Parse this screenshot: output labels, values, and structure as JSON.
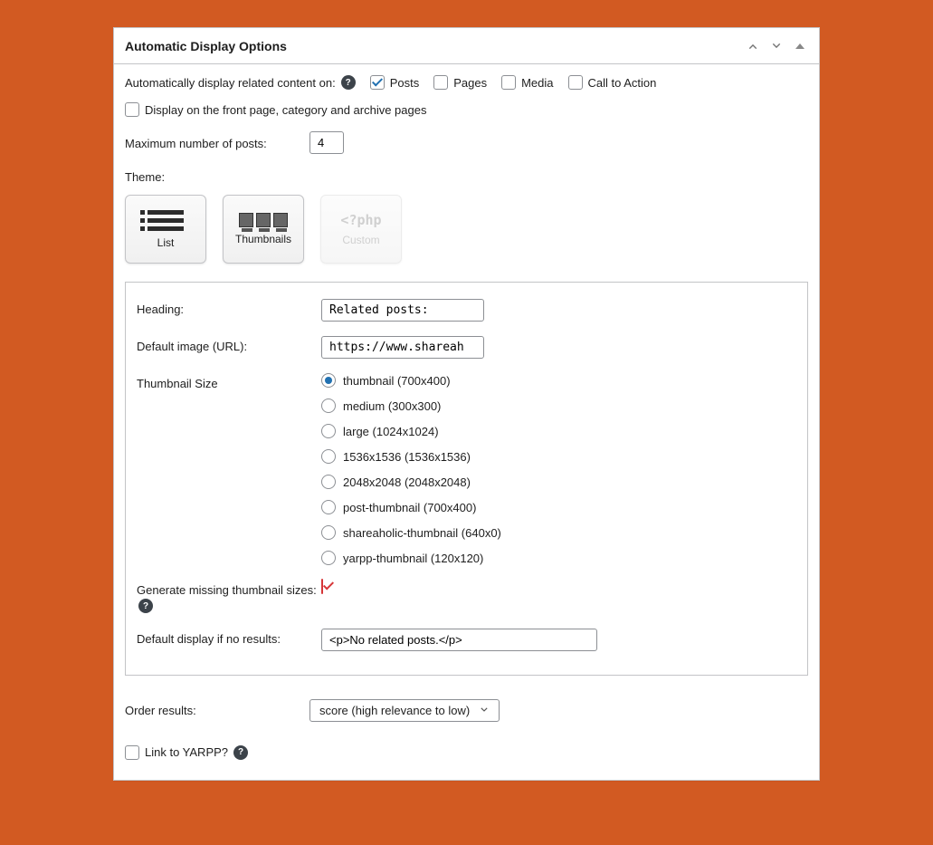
{
  "panel_title": "Automatic Display Options",
  "auto_display_label": "Automatically display related content on:",
  "content_types": [
    {
      "label": "Posts",
      "checked": true
    },
    {
      "label": "Pages",
      "checked": false
    },
    {
      "label": "Media",
      "checked": false
    },
    {
      "label": "Call to Action",
      "checked": false
    }
  ],
  "front_page": {
    "label": "Display on the front page, category and archive pages",
    "checked": false
  },
  "max_posts": {
    "label": "Maximum number of posts:",
    "value": "4"
  },
  "theme": {
    "label": "Theme:",
    "options": [
      {
        "key": "list",
        "label": "List"
      },
      {
        "key": "thumbnails",
        "label": "Thumbnails"
      },
      {
        "key": "custom",
        "label": "Custom",
        "php_text": "<?php"
      }
    ]
  },
  "heading": {
    "label": "Heading:",
    "value": "Related posts:"
  },
  "default_image": {
    "label": "Default image (URL):",
    "value": "https://www.shareah"
  },
  "thumb_size": {
    "label": "Thumbnail Size",
    "options": [
      {
        "label": "thumbnail (700x400)",
        "selected": true
      },
      {
        "label": "medium (300x300)",
        "selected": false
      },
      {
        "label": "large (1024x1024)",
        "selected": false
      },
      {
        "label": "1536x1536 (1536x1536)",
        "selected": false
      },
      {
        "label": "2048x2048 (2048x2048)",
        "selected": false
      },
      {
        "label": "post-thumbnail (700x400)",
        "selected": false
      },
      {
        "label": "shareaholic-thumbnail (640x0)",
        "selected": false
      },
      {
        "label": "yarpp-thumbnail (120x120)",
        "selected": false
      }
    ]
  },
  "generate_missing": {
    "label": "Generate missing thumbnail sizes:",
    "checked": true
  },
  "no_results": {
    "label": "Default display if no results:",
    "value": "<p>No related posts.</p>"
  },
  "order": {
    "label": "Order results:",
    "value": "score (high relevance to low)"
  },
  "link_yarpp": {
    "label": "Link to YARPP?",
    "checked": false
  }
}
